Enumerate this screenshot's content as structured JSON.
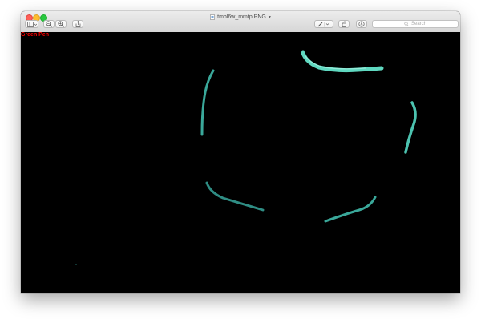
{
  "window": {
    "title": "tmpl6w_mmtp.PNG"
  },
  "toolbar": {
    "buttons": [
      {
        "name": "sidebar-toggle-button",
        "icon": "sidebar-icon"
      },
      {
        "name": "zoom-out-button",
        "icon": "zoom-out-icon"
      },
      {
        "name": "zoom-in-button",
        "icon": "zoom-in-icon"
      },
      {
        "name": "share-button",
        "icon": "share-icon"
      },
      {
        "name": "markup-pen-button",
        "icon": "pen-icon"
      },
      {
        "name": "rotate-button",
        "icon": "rotate-icon"
      },
      {
        "name": "markup-toolbar-button",
        "icon": "markup-icon"
      }
    ],
    "search_placeholder": "Search"
  },
  "canvas": {
    "label": "Green Pen",
    "label_color": "#ff0000",
    "background": "#000000",
    "stroke_color": "#5fd8c0"
  }
}
